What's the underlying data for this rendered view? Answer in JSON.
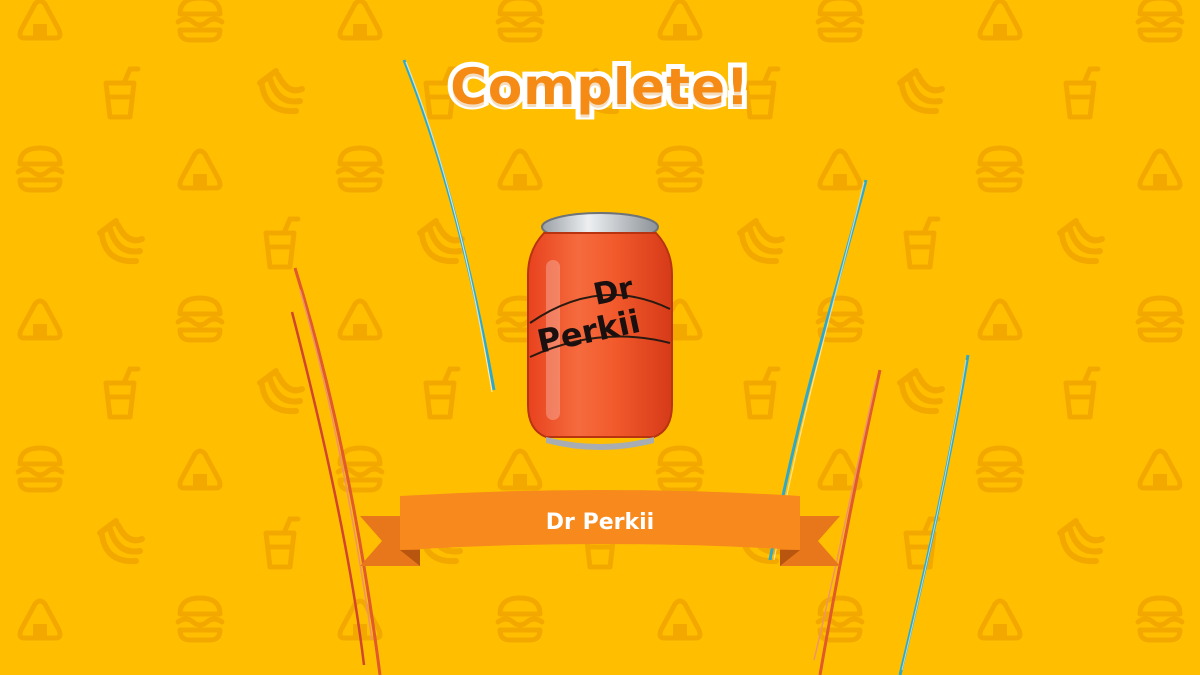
{
  "screen": {
    "heading": "Complete!",
    "item_name": "Dr Perkii",
    "can_logo_top": "Dr",
    "can_logo_bottom": "Perkii"
  },
  "theme": {
    "background": "#FFBF00",
    "pattern_color": "#F3A800",
    "heading_color": "#F58A14",
    "banner_color": "#F7891D",
    "can_color": "#F2552A"
  },
  "background_icons": [
    "onigiri-icon",
    "drink-cup-icon",
    "burger-icon",
    "banana-icon"
  ]
}
